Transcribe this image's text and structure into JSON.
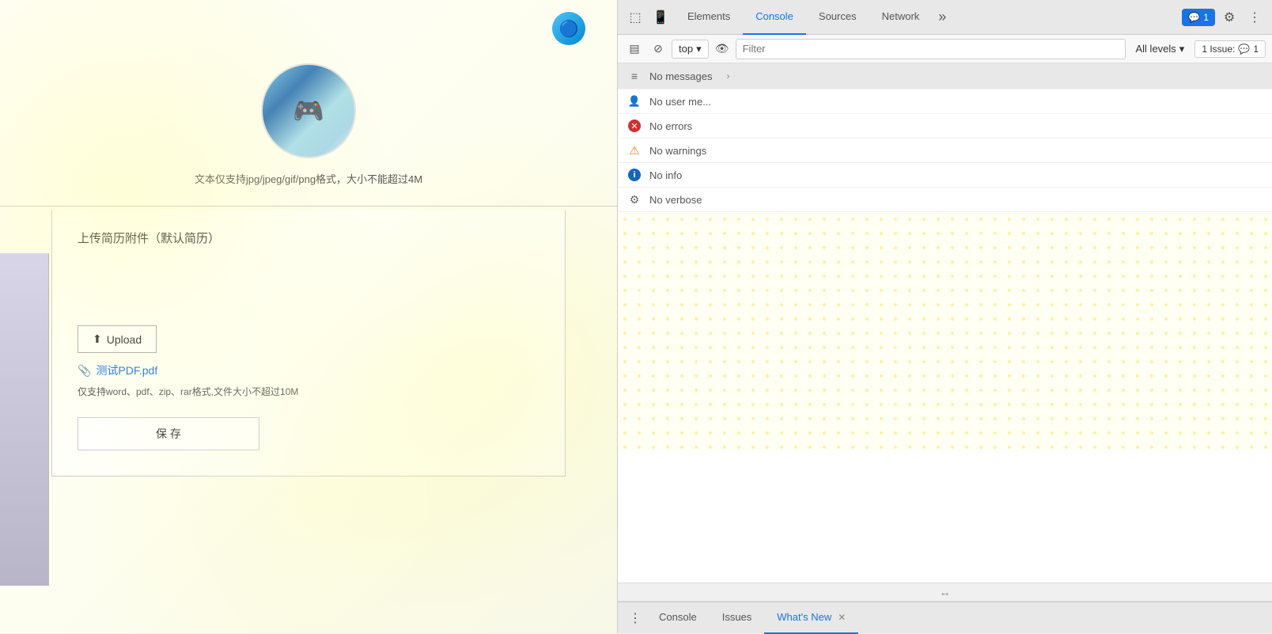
{
  "browser_page": {
    "logo": "🔵",
    "avatar": {
      "hint": "文本仅支持jpg/jpeg/gif/png格式，大小不能超过4M"
    },
    "resume": {
      "title": "上传简历附件（默认简历）",
      "upload_btn": "Upload",
      "file_name": "测试PDF.pdf",
      "file_hint": "仅支持word、pdf、zip、rar格式,文件大小不超过10M",
      "save_btn": "保 存"
    }
  },
  "devtools": {
    "header": {
      "tabs": [
        "Elements",
        "Console",
        "Sources",
        "Network"
      ],
      "active_tab": "Console",
      "more_btn": "»",
      "badge_label": "1",
      "settings_icon": "⚙",
      "dots_icon": "⋮"
    },
    "toolbar": {
      "sidebar_icon": "▤",
      "block_icon": "⊘",
      "context_label": "top",
      "eye_icon": "👁",
      "filter_placeholder": "Filter",
      "levels_label": "All levels",
      "issue_label": "1 Issue:",
      "issue_count": "1"
    },
    "console_items": [
      {
        "id": "no-messages",
        "icon_type": "list",
        "icon": "≡",
        "text": "No messages",
        "has_chevron": true
      },
      {
        "id": "no-user",
        "icon_type": "user",
        "icon": "👤",
        "text": "No user me..."
      },
      {
        "id": "no-errors",
        "icon_type": "error",
        "icon": "✕",
        "text": "No errors"
      },
      {
        "id": "no-warnings",
        "icon_type": "warning",
        "icon": "⚠",
        "text": "No warnings"
      },
      {
        "id": "no-info",
        "icon_type": "info",
        "icon": "ℹ",
        "text": "No info"
      },
      {
        "id": "no-verbose",
        "icon_type": "verbose",
        "icon": "⚙",
        "text": "No verbose"
      }
    ],
    "bottom_tabs": [
      "Console",
      "Issues",
      "What's New"
    ],
    "active_bottom_tab": "What's New",
    "resize_icon": "↔"
  }
}
